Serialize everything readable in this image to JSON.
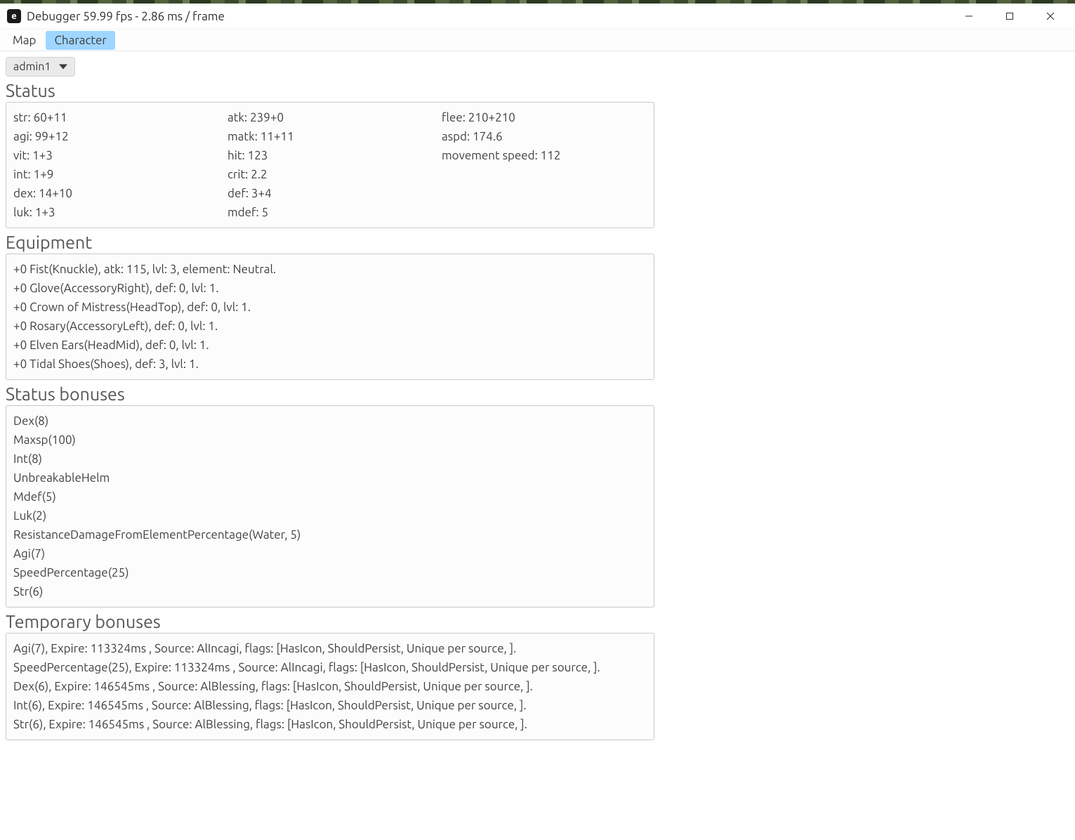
{
  "window": {
    "title": "Debugger 59.99 fps - 2.86 ms / frame",
    "icon_letter": "e"
  },
  "menubar": {
    "items": [
      {
        "label": "Map",
        "active": false
      },
      {
        "label": "Character",
        "active": true
      }
    ]
  },
  "character_select": {
    "value": "admin1"
  },
  "sections": {
    "status": {
      "title": "Status",
      "col1": [
        {
          "text": "str: 60+11"
        },
        {
          "text": "agi: 99+12"
        },
        {
          "text": "vit: 1+3"
        },
        {
          "text": "int: 1+9"
        },
        {
          "text": "dex: 14+10"
        },
        {
          "text": "luk: 1+3"
        }
      ],
      "col2": [
        {
          "text": "atk: 239+0"
        },
        {
          "text": "matk: 11+11"
        },
        {
          "text": "hit: 123"
        },
        {
          "text": "crit: 2.2"
        },
        {
          "text": "def: 3+4"
        },
        {
          "text": "mdef: 5"
        }
      ],
      "col3": [
        {
          "text": "flee: 210+210"
        },
        {
          "text": "aspd: 174.6"
        },
        {
          "text": "movement speed: 112"
        }
      ]
    },
    "equipment": {
      "title": "Equipment",
      "items": [
        {
          "text": "+0 Fist(Knuckle), atk: 115, lvl: 3, element: Neutral."
        },
        {
          "text": "+0 Glove(AccessoryRight), def: 0, lvl: 1."
        },
        {
          "text": "+0 Crown of Mistress(HeadTop), def: 0, lvl: 1."
        },
        {
          "text": "+0 Rosary(AccessoryLeft), def: 0, lvl: 1."
        },
        {
          "text": "+0 Elven Ears(HeadMid), def: 0, lvl: 1."
        },
        {
          "text": "+0 Tidal Shoes(Shoes), def: 3, lvl: 1."
        }
      ]
    },
    "status_bonuses": {
      "title": "Status bonuses",
      "items": [
        {
          "text": "Dex(8)"
        },
        {
          "text": "Maxsp(100)"
        },
        {
          "text": "Int(8)"
        },
        {
          "text": "UnbreakableHelm"
        },
        {
          "text": "Mdef(5)"
        },
        {
          "text": "Luk(2)"
        },
        {
          "text": "ResistanceDamageFromElementPercentage(Water, 5)"
        },
        {
          "text": "Agi(7)"
        },
        {
          "text": "SpeedPercentage(25)"
        },
        {
          "text": "Str(6)"
        }
      ]
    },
    "temporary_bonuses": {
      "title": "Temporary bonuses",
      "items": [
        {
          "text": "Agi(7), Expire:  113324ms , Source: AlIncagi, flags: [HasIcon, ShouldPersist, Unique per source, ]."
        },
        {
          "text": "SpeedPercentage(25), Expire:  113324ms , Source: AlIncagi, flags: [HasIcon, ShouldPersist, Unique per source, ]."
        },
        {
          "text": "Dex(6), Expire:  146545ms , Source: AlBlessing, flags: [HasIcon, ShouldPersist, Unique per source, ]."
        },
        {
          "text": "Int(6), Expire:  146545ms , Source: AlBlessing, flags: [HasIcon, ShouldPersist, Unique per source, ]."
        },
        {
          "text": "Str(6), Expire:  146545ms , Source: AlBlessing, flags: [HasIcon, ShouldPersist, Unique per source, ]."
        }
      ]
    }
  }
}
